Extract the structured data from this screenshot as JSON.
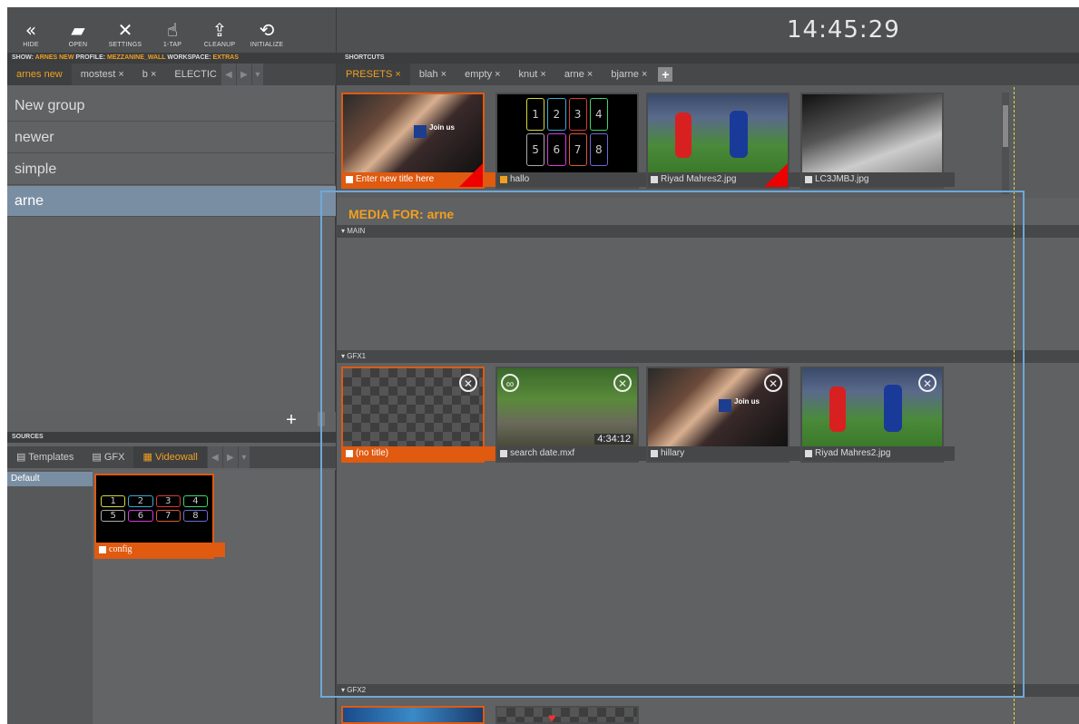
{
  "clock": "14:45:29",
  "toolbar": {
    "buttons": [
      {
        "icon": "«",
        "label": "HIDE"
      },
      {
        "icon": "▰",
        "label": "OPEN"
      },
      {
        "icon": "✕",
        "label": "SETTINGS"
      },
      {
        "icon": "☝",
        "label": "1-TAP"
      },
      {
        "icon": "⇪",
        "label": "CLEANUP"
      },
      {
        "icon": "⟲",
        "label": "INITIALIZE"
      }
    ]
  },
  "status": {
    "show_label": "SHOW:",
    "show": "ARNES NEW",
    "profile_label": "PROFILE:",
    "profile": "MEZZANINE_WALL",
    "workspace_label": "WORKSPACE:",
    "workspace": "EXTRAS"
  },
  "shortcuts_label": "SHORTCUTS",
  "show_tabs": [
    "arnes new",
    "mostest ×",
    "b ×",
    "ELECTIC"
  ],
  "shortcut_tabs": [
    "PRESETS ×",
    "blah ×",
    "empty ×",
    "knut ×",
    "arne ×",
    "bjarne ×"
  ],
  "add_tab": "+",
  "groups": [
    "New group",
    "newer",
    "simple",
    "arne"
  ],
  "add_group": "+",
  "sources_label": "SOURCES",
  "source_tabs": [
    "Templates",
    "GFX",
    "Videowall"
  ],
  "source_default": "Default",
  "config_item": {
    "label": "config",
    "cells": [
      "1",
      "2",
      "3",
      "4",
      "5",
      "6",
      "7",
      "8"
    ]
  },
  "presets": [
    {
      "title": "Enter new title here",
      "overlay": "Join us"
    },
    {
      "title": "hallo",
      "cells": [
        "1",
        "2",
        "3",
        "4",
        "5",
        "6",
        "7",
        "8"
      ]
    },
    {
      "title": "Riyad Mahres2.jpg"
    },
    {
      "title": "LC3JMBJ.jpg"
    }
  ],
  "media_for_label": "MEDIA FOR:",
  "media_for_name": "arne",
  "sections": {
    "main": "▾ MAIN",
    "gfx1": "▾ GFX1",
    "gfx2": "▾ GFX2"
  },
  "gfx1_items": [
    {
      "title": "(no title)"
    },
    {
      "title": "search date.mxf",
      "duration": "4:34:12",
      "loop": "∞"
    },
    {
      "title": "hillary",
      "overlay": "Join us"
    },
    {
      "title": "Riyad Mahres2.jpg"
    }
  ],
  "colors": {
    "accent": "#f0a020",
    "selected": "#e05a10",
    "highlight": "#6fa8d8"
  }
}
